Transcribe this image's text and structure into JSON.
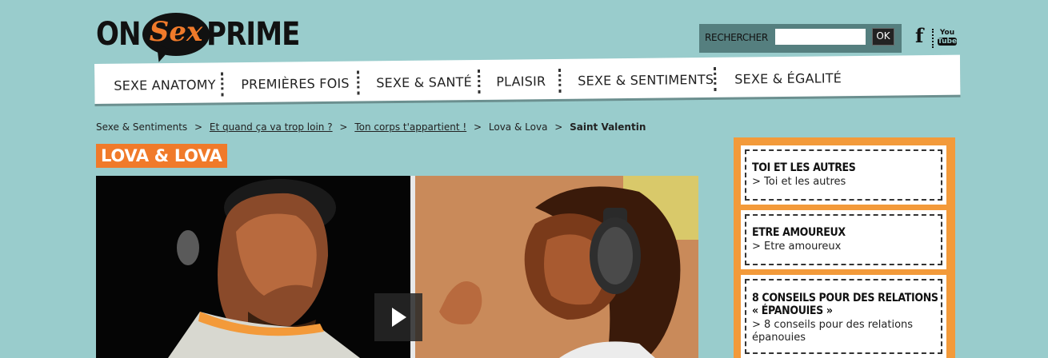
{
  "logo": {
    "part1": "ON",
    "part2": "Sex",
    "part3": "PRIME"
  },
  "search": {
    "label": "RECHERCHER",
    "value": "",
    "placeholder": "",
    "button": "OK"
  },
  "social": {
    "facebook": "f",
    "youtube_top": "You",
    "youtube_bottom": "Tube"
  },
  "nav": {
    "items": [
      {
        "label": "SEXE ANATOMY"
      },
      {
        "label": "PREMIÈRES FOIS"
      },
      {
        "label": "SEXE & SANTÉ"
      },
      {
        "label": "PLAISIR"
      },
      {
        "label": "SEXE & SENTIMENTS"
      },
      {
        "label": "SEXE & ÉGALITÉ"
      }
    ]
  },
  "breadcrumb": {
    "items": [
      {
        "label": "Sexe & Sentiments",
        "link": false
      },
      {
        "label": "Et quand ça va trop loin ?",
        "link": true
      },
      {
        "label": "Ton corps t'appartient !",
        "link": true
      },
      {
        "label": "Lova & Lova",
        "link": false
      },
      {
        "label": "Saint Valentin",
        "link": false,
        "current": true
      }
    ],
    "separator": ">"
  },
  "page": {
    "title": "LOVA & LOVA"
  },
  "sidebar": {
    "cards": [
      {
        "title": "TOI ET LES AUTRES",
        "link": "> Toi et les autres"
      },
      {
        "title": "ETRE AMOUREUX",
        "link": "> Etre amoureux"
      },
      {
        "title_line1": "8 CONSEILS POUR DES RELATIONS",
        "title_line2": "« ÉPANOUIES »",
        "link_line1": "> 8 conseils pour des relations",
        "link_line2": "épanouies"
      }
    ]
  },
  "colors": {
    "background": "#99cccc",
    "accent": "#f07a2a",
    "sidebar": "#f39a3a",
    "search_bg": "#557f7f"
  },
  "icons": {
    "play": "play-icon",
    "facebook": "facebook-icon",
    "youtube": "youtube-icon"
  }
}
